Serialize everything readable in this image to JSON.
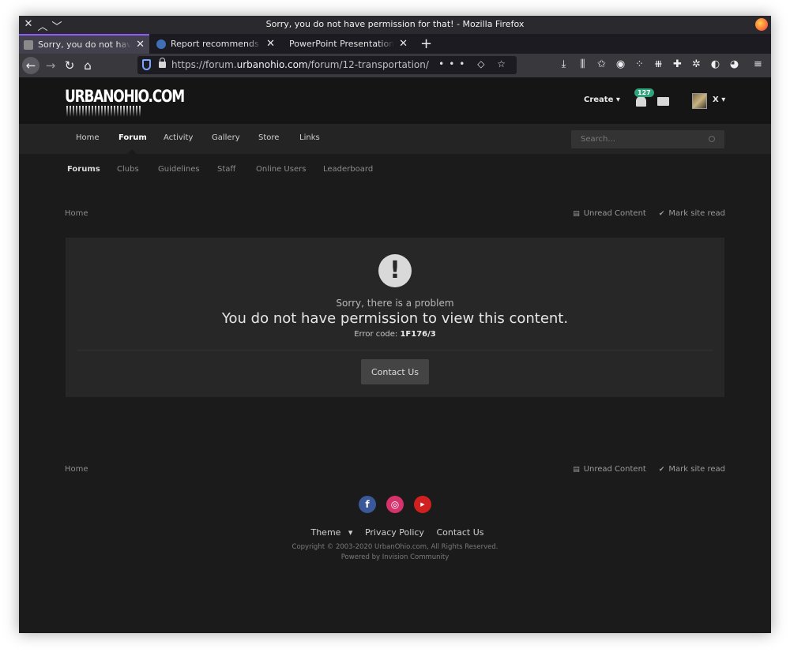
{
  "window": {
    "title": "Sorry, you do not have permission for that! - Mozilla Firefox"
  },
  "tabs": [
    {
      "label": "Sorry, you do not have permission for that!",
      "icon": "urbanohio-favicon",
      "active": true
    },
    {
      "label": "Report recommends Cleveland",
      "icon": "cleveland-favicon",
      "active": false
    },
    {
      "label": "PowerPoint Presentation - Cover",
      "icon": "",
      "active": false
    }
  ],
  "browser": {
    "url_prefix": "https://forum.",
    "url_domain": "urbanohio.com",
    "url_path": "/forum/12-transportation/",
    "url_actions": "••• ◇ ☆"
  },
  "site": {
    "logo_text": "URBANOHIO.COM",
    "create_label": "Create",
    "notification_count": "127",
    "user_name": "X"
  },
  "nav_primary": [
    "Home",
    "Forum",
    "Activity",
    "Gallery",
    "Store",
    "Links"
  ],
  "search_placeholder": "Search...",
  "nav_secondary": [
    "Forums",
    "Clubs",
    "Guidelines",
    "Staff",
    "Online Users",
    "Leaderboard"
  ],
  "breadcrumb": {
    "home": "Home",
    "unread": "Unread Content",
    "mark_read": "Mark site read"
  },
  "error": {
    "subtitle": "Sorry, there is a problem",
    "message": "You do not have permission to view this content.",
    "code_label": "Error code:",
    "code_value": "1F176/3",
    "contact_button": "Contact Us"
  },
  "footer": {
    "theme": "Theme",
    "privacy": "Privacy Policy",
    "contact": "Contact Us",
    "copyright": "Copyright © 2003-2020 UrbanOhio.com, All Rights Reserved.",
    "powered": "Powered by Invision Community"
  },
  "colors": {
    "badge": "#2fa37b",
    "facebook": "#3b5998",
    "instagram": "#d6336c",
    "youtube": "#d02020"
  }
}
